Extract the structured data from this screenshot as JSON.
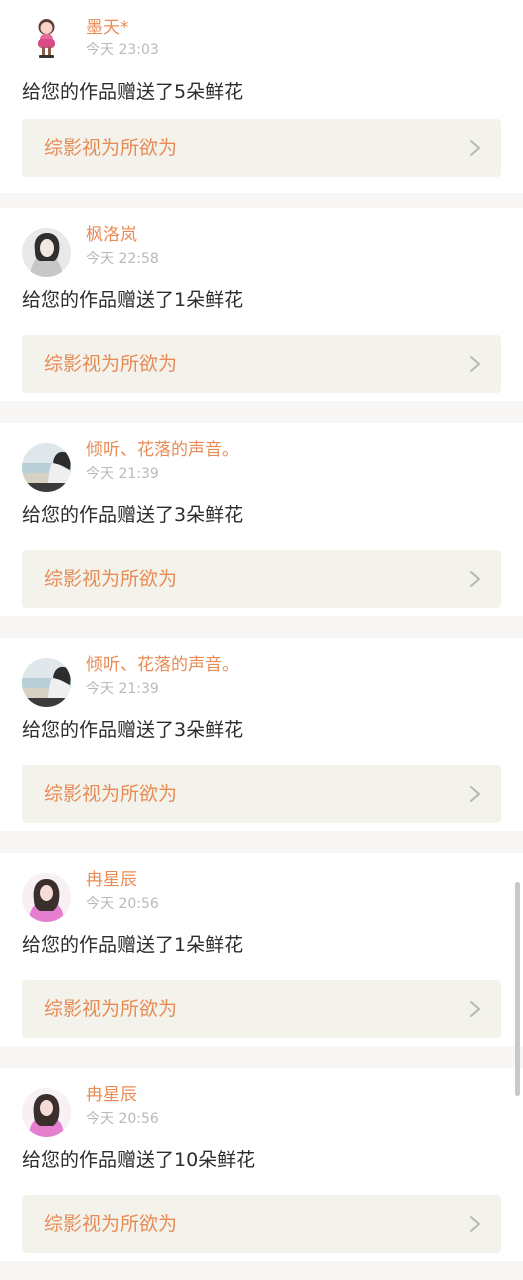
{
  "notifications": [
    {
      "username": "墨天*",
      "time": "今天 23:03",
      "message": "给您的作品赠送了5朵鲜花",
      "work_title": "综影视为所欲为",
      "avatar_icon": "doll-avatar-icon"
    },
    {
      "username": "枫洛岚",
      "time": "今天 22:58",
      "message": "给您的作品赠送了1朵鲜花",
      "work_title": "综影视为所欲为",
      "avatar_icon": "portrait-avatar-icon"
    },
    {
      "username": "倾听、花落的声音。",
      "time": "今天 21:39",
      "message": "给您的作品赠送了3朵鲜花",
      "work_title": "综影视为所欲为",
      "avatar_icon": "seaside-avatar-icon"
    },
    {
      "username": "倾听、花落的声音。",
      "time": "今天 21:39",
      "message": "给您的作品赠送了3朵鲜花",
      "work_title": "综影视为所欲为",
      "avatar_icon": "seaside-avatar-icon"
    },
    {
      "username": "冉星辰",
      "time": "今天 20:56",
      "message": "给您的作品赠送了1朵鲜花",
      "work_title": "综影视为所欲为",
      "avatar_icon": "pink-portrait-avatar-icon"
    },
    {
      "username": "冉星辰",
      "time": "今天 20:56",
      "message": "给您的作品赠送了10朵鲜花",
      "work_title": "综影视为所欲为",
      "avatar_icon": "pink-portrait-avatar-icon"
    }
  ],
  "colors": {
    "accent": "#e88b55",
    "time": "#b9b9b9",
    "text": "#2c2c2c",
    "link_background": "#f3f3ec",
    "page_background": "#f7f6f4"
  },
  "scroll": {
    "thumb_position_fraction": 0.69
  }
}
